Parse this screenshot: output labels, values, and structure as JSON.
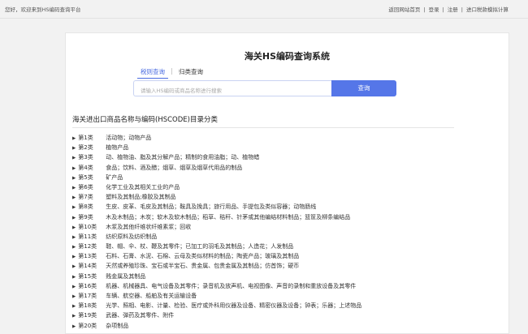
{
  "topbar": {
    "welcome": "您好，欢迎来到HS编码查询平台",
    "links": [
      "返回网站首页",
      "登录",
      "注册",
      "进口税款模拟计算"
    ]
  },
  "main": {
    "title": "海关HS编码查询系统",
    "tabs": [
      {
        "label": "税则查询"
      },
      {
        "label": "归类查询"
      }
    ],
    "search": {
      "placeholder": "请输入HS编码或商品名称进行搜索",
      "button": "查询"
    },
    "section_title": "海关进出口商品名称与编码(HSCODE)目录分类",
    "categories": [
      {
        "num": "第1类",
        "name": "活动物；动物产品"
      },
      {
        "num": "第2类",
        "name": "植物产品"
      },
      {
        "num": "第3类",
        "name": "动、植物油、脂及其分解产品；精制的食用油脂；动、植物蜡"
      },
      {
        "num": "第4类",
        "name": "食品；饮料、酒及醋；烟草、烟草及烟草代用品的制品"
      },
      {
        "num": "第5类",
        "name": "矿产品"
      },
      {
        "num": "第6类",
        "name": "化学工业及其相关工业的产品"
      },
      {
        "num": "第7类",
        "name": "塑料及其制品;橡胶及其制品"
      },
      {
        "num": "第8类",
        "name": "生皮、皮革、毛皮及其制品；鞍具及挽具；旅行用品、手提包及类似容器；动物肠线"
      },
      {
        "num": "第9类",
        "name": "木及木制品；木炭；软木及软木制品；稻草、秸秆、针茅或其他编结材料制品；篮筐及柳条编结品"
      },
      {
        "num": "第10类",
        "name": "木浆及其他纤维状纤维素浆；回收"
      },
      {
        "num": "第11类",
        "name": "纺织原料及纺织制品"
      },
      {
        "num": "第12类",
        "name": "鞋、帽、伞、杖、鞭及其零件；已加工的羽毛及其制品；人造花；人发制品"
      },
      {
        "num": "第13类",
        "name": "石料、石膏、水泥、石棉、云母及类似材料的制品；陶瓷产品；玻璃及其制品"
      },
      {
        "num": "第14类",
        "name": "天然或养殖珍珠、宝石或半宝石、贵金属、包贵金属及其制品；仿首饰；硬币"
      },
      {
        "num": "第15类",
        "name": "贱金属及其制品"
      },
      {
        "num": "第16类",
        "name": "机器、机械器具、电气设备及其零件；录音机及放声机、电视图像、声音的录制和重放设备及其零件"
      },
      {
        "num": "第17类",
        "name": "车辆、航空器、船舶及有关运输设备"
      },
      {
        "num": "第18类",
        "name": "光学、照相、电影、计量、检验、医疗或外科用仪器及设备、精密仪器及设备；钟表；乐器；上述物品"
      },
      {
        "num": "第19类",
        "name": "武器、弹药及其零件、附件"
      },
      {
        "num": "第20类",
        "name": "杂项制品"
      }
    ]
  }
}
